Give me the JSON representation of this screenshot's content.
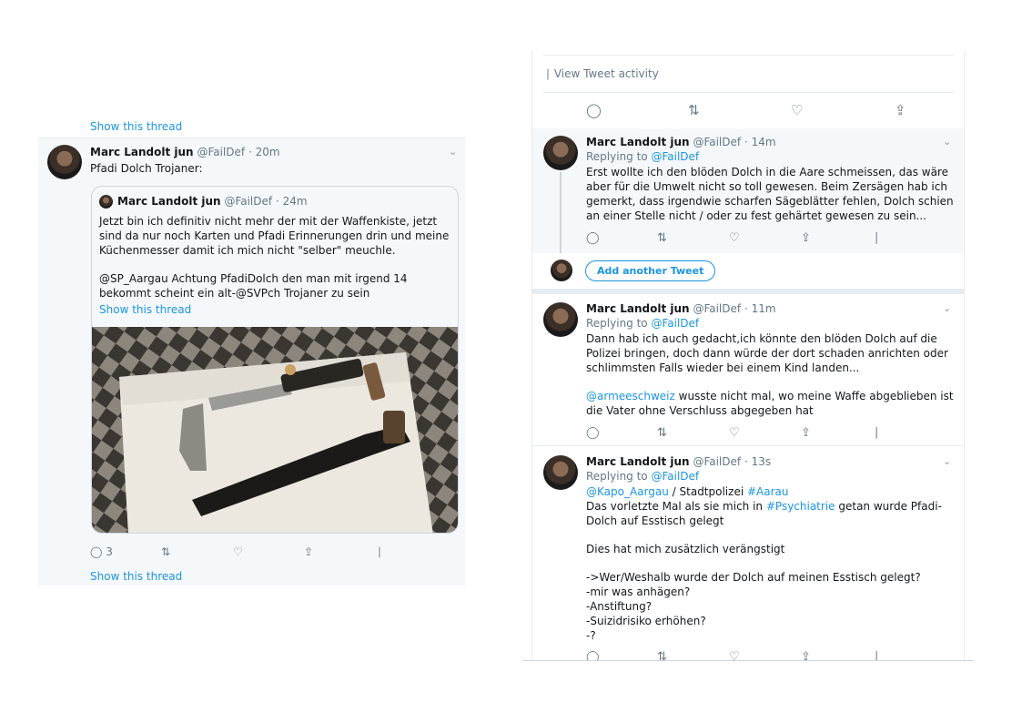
{
  "left": {
    "show_thread_top": "Show this thread",
    "author_name": "Marc Landolt jun",
    "author_handle": "@FailDef",
    "time": "· 20m",
    "text": "Pfadi Dolch Trojaner:",
    "quote": {
      "author_name": "Marc Landolt jun",
      "author_handle": "@FailDef",
      "time": "· 24m",
      "paragraphs": [
        "Jetzt bin ich definitiv nicht mehr der mit der Waffenkiste, jetzt sind da nur noch Karten und Pfadi Erinnerungen drin und meine Küchenmesser damit ich mich nicht \"selber\" meuchle.",
        "@SP_Aargau Achtung PfadiDolch den man mit irgend 14 bekommt scheint ein alt-@SVPch Trojaner zu sein"
      ],
      "show_thread": "Show this thread"
    },
    "reply_count": "3",
    "show_thread_bottom": "Show this thread"
  },
  "right": {
    "view_activity": "View Tweet activity",
    "add_tweet_label": "Add another Tweet",
    "tweets": [
      {
        "author_name": "Marc Landolt jun",
        "author_handle": "@FailDef",
        "time": "· 14m",
        "replying_label": "Replying to",
        "replying_to": "@FailDef",
        "paragraphs": [
          "Erst wollte ich den blöden Dolch in die Aare schmeissen, das wäre aber für die Umwelt nicht so toll gewesen. Beim Zersägen hab ich gemerkt, dass irgendwie scharfen Sägeblätter fehlen, Dolch schien an einer Stelle nicht / oder zu fest gehärtet gewesen zu sein..."
        ]
      },
      {
        "author_name": "Marc Landolt jun",
        "author_handle": "@FailDef",
        "time": "· 11m",
        "replying_label": "Replying to",
        "replying_to": "@FailDef",
        "paragraph1": "Dann hab ich auch gedacht,ich könnte den blöden Dolch auf die Polizei bringen, doch dann würde der dort schaden anrichten oder schlimmsten Falls wieder bei einem Kind landen...",
        "mention": "@armeeschweiz",
        "paragraph2_rest": " wusste nicht mal, wo meine Waffe abgeblieben ist die Vater ohne Verschluss abgegeben hat"
      },
      {
        "author_name": "Marc Landolt jun",
        "author_handle": "@FailDef",
        "time": "· 13s",
        "replying_label": "Replying to",
        "replying_to": "@FailDef",
        "mention1": "@Kapo_Aargau",
        "mid1": " / Stadtpolizei ",
        "hashtag1": "#Aarau",
        "line2_start": "Das vorletzte Mal als sie mich in ",
        "hashtag2": "#Psychiatrie",
        "line2_end": " getan wurde  Pfadi-Dolch auf Esstisch gelegt",
        "line3": "Dies hat mich zusätzlich verängstigt",
        "questions": [
          "->Wer/Weshalb wurde der Dolch auf meinen Esstisch gelegt?",
          "-mir was anhägen?",
          "-Anstiftung?",
          "-Suizidrisiko erhöhen?",
          "-?"
        ]
      }
    ]
  },
  "icons": {
    "reply": "reply-icon",
    "retweet": "retweet-icon",
    "like": "like-icon",
    "share": "share-icon",
    "analytics": "analytics-icon",
    "chevron": "chevron-down-icon"
  },
  "colors": {
    "link": "#1b95e0",
    "muted": "#657786",
    "panel_bg": "#f5f8fa"
  }
}
